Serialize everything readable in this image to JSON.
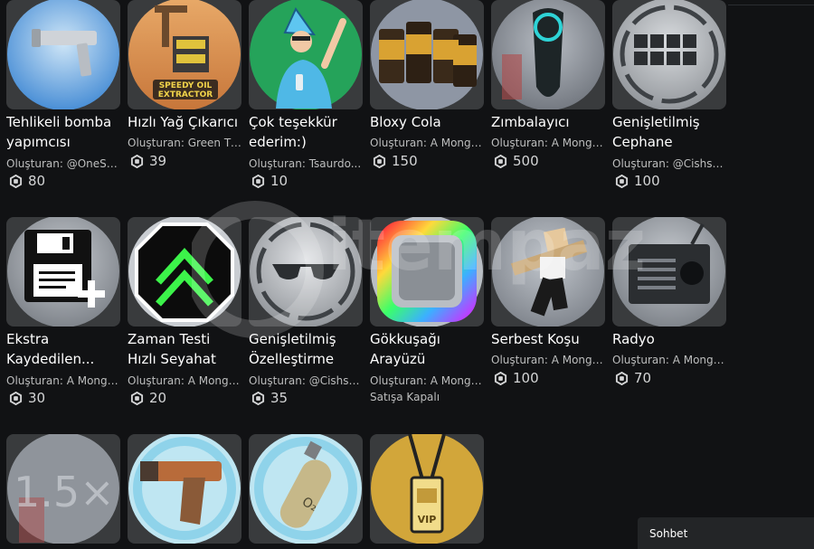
{
  "items": [
    {
      "name": "Tehlikeli bomba yapımcısı",
      "creator": "Oluşturan: @OneSky...",
      "price": "80",
      "icon": "launcher-gun-icon"
    },
    {
      "name": "Hızlı Yağ Çıkarıcı",
      "creator": "Oluşturan: Green Tit...",
      "price": "39",
      "icon": "oil-extractor-icon"
    },
    {
      "name": "Çok teşekkür ederim:)",
      "creator": "Oluşturan: Tsaurdo...",
      "price": "10",
      "icon": "wizard-thanks-icon"
    },
    {
      "name": "Bloxy Cola",
      "creator": "Oluşturan: A Mongo...",
      "price": "150",
      "icon": "bloxy-cola-icon"
    },
    {
      "name": "Zımbalayıcı",
      "creator": "Oluşturan: A Mongo...",
      "price": "500",
      "icon": "stapler-icon"
    },
    {
      "name": "Genişletilmiş Cephane",
      "creator": "Oluşturan: @Cishsha...",
      "price": "100",
      "icon": "ammo-grid-icon"
    },
    {
      "name": "Ekstra Kaydedilen...",
      "creator": "Oluşturan: A Mongo...",
      "price": "30",
      "icon": "floppy-plus-icon"
    },
    {
      "name": "Zaman Testi Hızlı Seyahat",
      "creator": "Oluşturan: A Mongo...",
      "price": "20",
      "icon": "chevron-up-badge-icon"
    },
    {
      "name": "Genişletilmiş Özelleştirme",
      "creator": "Oluşturan: @Cishsha...",
      "price": "35",
      "icon": "sunglasses-icon"
    },
    {
      "name": "Gökkuşağı Arayüzü",
      "creator": "Oluşturan: A Mongo...",
      "status": "Satışa Kapalı",
      "icon": "rainbow-frame-icon"
    },
    {
      "name": "Serbest Koşu",
      "creator": "Oluşturan: A Mongo...",
      "price": "100",
      "icon": "running-avatar-icon"
    },
    {
      "name": "Radyo",
      "creator": "Oluşturan: A Mongo...",
      "price": "70",
      "icon": "radio-icon"
    },
    {
      "icon": "speed-1-5x-icon"
    },
    {
      "icon": "flare-gun-icon"
    },
    {
      "icon": "oxygen-tank-icon"
    },
    {
      "icon": "vip-pass-icon"
    }
  ],
  "chat": {
    "label": "Sohbet"
  },
  "watermark": {
    "text": "itempazar.com"
  },
  "colors": {
    "background": "#111214",
    "tile": "#393b3d",
    "text": "#ffffff",
    "muted": "#bdbebe"
  }
}
